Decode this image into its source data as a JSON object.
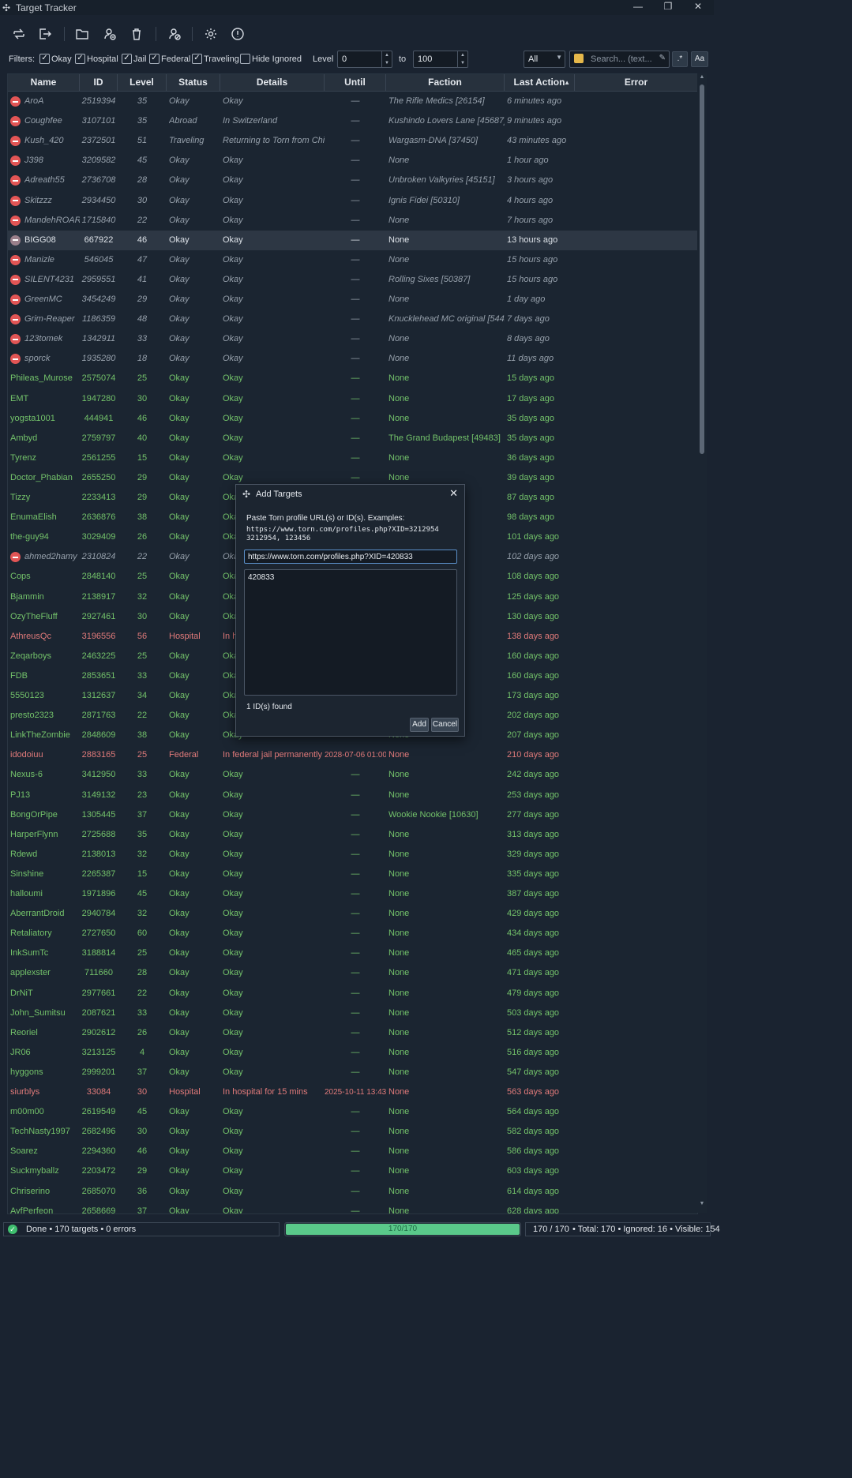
{
  "window": {
    "title": "Target Tracker"
  },
  "filters": {
    "label": "Filters:",
    "okay": "Okay",
    "hospital": "Hospital",
    "jail": "Jail",
    "federal": "Federal",
    "traveling": "Traveling",
    "hide_ignored": "Hide Ignored",
    "level_label": "Level",
    "level_min": "0",
    "to_label": "to",
    "level_max": "100",
    "scope": "All",
    "search_placeholder": "Search... (text..."
  },
  "table": {
    "columns": {
      "name": "Name",
      "id": "ID",
      "level": "Level",
      "status": "Status",
      "details": "Details",
      "until": "Until",
      "faction": "Faction",
      "last_action": "Last Action",
      "error": "Error"
    },
    "rows": [
      {
        "name": "AroA",
        "id": "2519394",
        "level": "35",
        "status": "Okay",
        "details": "Okay",
        "until": "—",
        "faction": "The Rifle Medics [26154]",
        "last": "6 minutes ago",
        "type": "ign"
      },
      {
        "name": "Coughfee",
        "id": "3107101",
        "level": "35",
        "status": "Abroad",
        "details": "In Switzerland",
        "until": "—",
        "faction": "Kushindo Lovers Lane [45687]",
        "last": "9 minutes ago",
        "type": "ign"
      },
      {
        "name": "Kush_420",
        "id": "2372501",
        "level": "51",
        "status": "Traveling",
        "details": "Returning to Torn from China",
        "until": "—",
        "faction": "Wargasm-DNA [37450]",
        "last": "43 minutes ago",
        "type": "ign"
      },
      {
        "name": "J398",
        "id": "3209582",
        "level": "45",
        "status": "Okay",
        "details": "Okay",
        "until": "—",
        "faction": "None",
        "last": "1 hour ago",
        "type": "ign"
      },
      {
        "name": "Adreath55",
        "id": "2736708",
        "level": "28",
        "status": "Okay",
        "details": "Okay",
        "until": "—",
        "faction": "Unbroken Valkyries [45151]",
        "last": "3 hours ago",
        "type": "ign"
      },
      {
        "name": "Skitzzz",
        "id": "2934450",
        "level": "30",
        "status": "Okay",
        "details": "Okay",
        "until": "—",
        "faction": "Ignis Fidei [50310]",
        "last": "4 hours ago",
        "type": "ign"
      },
      {
        "name": "MandehROAR",
        "id": "1715840",
        "level": "22",
        "status": "Okay",
        "details": "Okay",
        "until": "—",
        "faction": "None",
        "last": "7 hours ago",
        "type": "ign"
      },
      {
        "name": "BIGG08",
        "id": "667922",
        "level": "46",
        "status": "Okay",
        "details": "Okay",
        "until": "—",
        "faction": "None",
        "last": "13 hours ago",
        "type": "sel"
      },
      {
        "name": "Manizle",
        "id": "546045",
        "level": "47",
        "status": "Okay",
        "details": "Okay",
        "until": "—",
        "faction": "None",
        "last": "15 hours ago",
        "type": "ign"
      },
      {
        "name": "SILENT4231",
        "id": "2959551",
        "level": "41",
        "status": "Okay",
        "details": "Okay",
        "until": "—",
        "faction": "Rolling Sixes [50387]",
        "last": "15 hours ago",
        "type": "ign"
      },
      {
        "name": "GreenMC",
        "id": "3454249",
        "level": "29",
        "status": "Okay",
        "details": "Okay",
        "until": "—",
        "faction": "None",
        "last": "1 day ago",
        "type": "ign"
      },
      {
        "name": "Grim-Reaper",
        "id": "1186359",
        "level": "48",
        "status": "Okay",
        "details": "Okay",
        "until": "—",
        "faction": "Knucklehead MC original [54420]",
        "last": "7 days ago",
        "type": "ign"
      },
      {
        "name": "123tomek",
        "id": "1342911",
        "level": "33",
        "status": "Okay",
        "details": "Okay",
        "until": "—",
        "faction": "None",
        "last": "8 days ago",
        "type": "ign"
      },
      {
        "name": "sporck",
        "id": "1935280",
        "level": "18",
        "status": "Okay",
        "details": "Okay",
        "until": "—",
        "faction": "None",
        "last": "11 days ago",
        "type": "ign"
      },
      {
        "name": "Phileas_Murose",
        "id": "2575074",
        "level": "25",
        "status": "Okay",
        "details": "Okay",
        "until": "—",
        "faction": "None",
        "last": "15 days ago",
        "type": "ok"
      },
      {
        "name": "EMT",
        "id": "1947280",
        "level": "30",
        "status": "Okay",
        "details": "Okay",
        "until": "—",
        "faction": "None",
        "last": "17 days ago",
        "type": "ok"
      },
      {
        "name": "yogsta1001",
        "id": "444941",
        "level": "46",
        "status": "Okay",
        "details": "Okay",
        "until": "—",
        "faction": "None",
        "last": "35 days ago",
        "type": "ok"
      },
      {
        "name": "Ambyd",
        "id": "2759797",
        "level": "40",
        "status": "Okay",
        "details": "Okay",
        "until": "—",
        "faction": "The Grand Budapest [49483]",
        "last": "35 days ago",
        "type": "ok"
      },
      {
        "name": "Tyrenz",
        "id": "2561255",
        "level": "15",
        "status": "Okay",
        "details": "Okay",
        "until": "—",
        "faction": "None",
        "last": "36 days ago",
        "type": "ok"
      },
      {
        "name": "Doctor_Phabian",
        "id": "2655250",
        "level": "29",
        "status": "Okay",
        "details": "Okay",
        "until": "—",
        "faction": "None",
        "last": "39 days ago",
        "type": "ok"
      },
      {
        "name": "Tizzy",
        "id": "2233413",
        "level": "29",
        "status": "Okay",
        "details": "Okay",
        "until": "",
        "faction": "",
        "last": "87 days ago",
        "type": "ok"
      },
      {
        "name": "EnumaElish",
        "id": "2636876",
        "level": "38",
        "status": "Okay",
        "details": "Okay",
        "until": "",
        "faction": "",
        "last": "98 days ago",
        "type": "ok"
      },
      {
        "name": "the-guy94",
        "id": "3029409",
        "level": "26",
        "status": "Okay",
        "details": "Okay",
        "until": "",
        "faction": "",
        "last": "101 days ago",
        "type": "ok"
      },
      {
        "name": "ahmed2hamy",
        "id": "2310824",
        "level": "22",
        "status": "Okay",
        "details": "Okay",
        "until": "",
        "faction": "",
        "last": "102 days ago",
        "type": "ign"
      },
      {
        "name": "Cops",
        "id": "2848140",
        "level": "25",
        "status": "Okay",
        "details": "Okay",
        "until": "",
        "faction": "",
        "last": "108 days ago",
        "type": "ok"
      },
      {
        "name": "Bjammin",
        "id": "2138917",
        "level": "32",
        "status": "Okay",
        "details": "Okay",
        "until": "",
        "faction": "",
        "last": "125 days ago",
        "type": "ok"
      },
      {
        "name": "OzyTheFluff",
        "id": "2927461",
        "level": "30",
        "status": "Okay",
        "details": "Okay",
        "until": "",
        "faction": "",
        "last": "130 days ago",
        "type": "ok"
      },
      {
        "name": "AthreusQc",
        "id": "3196556",
        "level": "56",
        "status": "Hospital",
        "details": "In h",
        "until": "",
        "faction": "",
        "last": "138 days ago",
        "type": "hosp"
      },
      {
        "name": "Zeqarboys",
        "id": "2463225",
        "level": "25",
        "status": "Okay",
        "details": "Okay",
        "until": "",
        "faction": "",
        "last": "160 days ago",
        "type": "ok"
      },
      {
        "name": "FDB",
        "id": "2853651",
        "level": "33",
        "status": "Okay",
        "details": "Okay",
        "until": "",
        "faction": "",
        "last": "160 days ago",
        "type": "ok"
      },
      {
        "name": "5550123",
        "id": "1312637",
        "level": "34",
        "status": "Okay",
        "details": "Okay",
        "until": "",
        "faction": "",
        "last": "173 days ago",
        "type": "ok"
      },
      {
        "name": "presto2323",
        "id": "2871763",
        "level": "22",
        "status": "Okay",
        "details": "Okay",
        "until": "",
        "faction": "",
        "last": "202 days ago",
        "type": "ok"
      },
      {
        "name": "LinkTheZombie",
        "id": "2848609",
        "level": "38",
        "status": "Okay",
        "details": "Okay",
        "until": "",
        "faction": "None",
        "last": "207 days ago",
        "type": "ok"
      },
      {
        "name": "idodoiuu",
        "id": "2883165",
        "level": "25",
        "status": "Federal",
        "details": "In federal jail permanently",
        "until": "2028-07-06 01:00",
        "faction": "None",
        "last": "210 days ago",
        "type": "fed"
      },
      {
        "name": "Nexus-6",
        "id": "3412950",
        "level": "33",
        "status": "Okay",
        "details": "Okay",
        "until": "—",
        "faction": "None",
        "last": "242 days ago",
        "type": "ok"
      },
      {
        "name": "PJ13",
        "id": "3149132",
        "level": "23",
        "status": "Okay",
        "details": "Okay",
        "until": "—",
        "faction": "None",
        "last": "253 days ago",
        "type": "ok"
      },
      {
        "name": "BongOrPipe",
        "id": "1305445",
        "level": "37",
        "status": "Okay",
        "details": "Okay",
        "until": "—",
        "faction": "Wookie Nookie [10630]",
        "last": "277 days ago",
        "type": "ok"
      },
      {
        "name": "HarperFlynn",
        "id": "2725688",
        "level": "35",
        "status": "Okay",
        "details": "Okay",
        "until": "—",
        "faction": "None",
        "last": "313 days ago",
        "type": "ok"
      },
      {
        "name": "Rdewd",
        "id": "2138013",
        "level": "32",
        "status": "Okay",
        "details": "Okay",
        "until": "—",
        "faction": "None",
        "last": "329 days ago",
        "type": "ok"
      },
      {
        "name": "Sinshine",
        "id": "2265387",
        "level": "15",
        "status": "Okay",
        "details": "Okay",
        "until": "—",
        "faction": "None",
        "last": "335 days ago",
        "type": "ok"
      },
      {
        "name": "halloumi",
        "id": "1971896",
        "level": "45",
        "status": "Okay",
        "details": "Okay",
        "until": "—",
        "faction": "None",
        "last": "387 days ago",
        "type": "ok"
      },
      {
        "name": "AberrantDroid",
        "id": "2940784",
        "level": "32",
        "status": "Okay",
        "details": "Okay",
        "until": "—",
        "faction": "None",
        "last": "429 days ago",
        "type": "ok"
      },
      {
        "name": "Retaliatory",
        "id": "2727650",
        "level": "60",
        "status": "Okay",
        "details": "Okay",
        "until": "—",
        "faction": "None",
        "last": "434 days ago",
        "type": "ok"
      },
      {
        "name": "InkSumTc",
        "id": "3188814",
        "level": "25",
        "status": "Okay",
        "details": "Okay",
        "until": "—",
        "faction": "None",
        "last": "465 days ago",
        "type": "ok"
      },
      {
        "name": "applexster",
        "id": "711660",
        "level": "28",
        "status": "Okay",
        "details": "Okay",
        "until": "—",
        "faction": "None",
        "last": "471 days ago",
        "type": "ok"
      },
      {
        "name": "DrNiT",
        "id": "2977661",
        "level": "22",
        "status": "Okay",
        "details": "Okay",
        "until": "—",
        "faction": "None",
        "last": "479 days ago",
        "type": "ok"
      },
      {
        "name": "John_Sumitsu",
        "id": "2087621",
        "level": "33",
        "status": "Okay",
        "details": "Okay",
        "until": "—",
        "faction": "None",
        "last": "503 days ago",
        "type": "ok"
      },
      {
        "name": "Reoriel",
        "id": "2902612",
        "level": "26",
        "status": "Okay",
        "details": "Okay",
        "until": "—",
        "faction": "None",
        "last": "512 days ago",
        "type": "ok"
      },
      {
        "name": "JR06",
        "id": "3213125",
        "level": "4",
        "status": "Okay",
        "details": "Okay",
        "until": "—",
        "faction": "None",
        "last": "516 days ago",
        "type": "ok"
      },
      {
        "name": "hyggons",
        "id": "2999201",
        "level": "37",
        "status": "Okay",
        "details": "Okay",
        "until": "—",
        "faction": "None",
        "last": "547 days ago",
        "type": "ok"
      },
      {
        "name": "siurblys",
        "id": "33084",
        "level": "30",
        "status": "Hospital",
        "details": "In hospital for 15 mins",
        "until": "2025-10-11 13:43",
        "faction": "None",
        "last": "563 days ago",
        "type": "hosp"
      },
      {
        "name": "m00m00",
        "id": "2619549",
        "level": "45",
        "status": "Okay",
        "details": "Okay",
        "until": "—",
        "faction": "None",
        "last": "564 days ago",
        "type": "ok"
      },
      {
        "name": "TechNasty1997",
        "id": "2682496",
        "level": "30",
        "status": "Okay",
        "details": "Okay",
        "until": "—",
        "faction": "None",
        "last": "582 days ago",
        "type": "ok"
      },
      {
        "name": "Soarez",
        "id": "2294360",
        "level": "46",
        "status": "Okay",
        "details": "Okay",
        "until": "—",
        "faction": "None",
        "last": "586 days ago",
        "type": "ok"
      },
      {
        "name": "Suckmyballz",
        "id": "2203472",
        "level": "29",
        "status": "Okay",
        "details": "Okay",
        "until": "—",
        "faction": "None",
        "last": "603 days ago",
        "type": "ok"
      },
      {
        "name": "Chriserino",
        "id": "2685070",
        "level": "36",
        "status": "Okay",
        "details": "Okay",
        "until": "—",
        "faction": "None",
        "last": "614 days ago",
        "type": "ok"
      },
      {
        "name": "AvfPerfeon",
        "id": "2658669",
        "level": "37",
        "status": "Okay",
        "details": "Okay",
        "until": "—",
        "faction": "None",
        "last": "628 days ago",
        "type": "ok"
      }
    ]
  },
  "dialog": {
    "title": "Add Targets",
    "instructions": "Paste Torn profile URL(s) or ID(s). Examples:",
    "example1": "https://www.torn.com/profiles.php?XID=3212954",
    "example2": "3212954, 123456",
    "input_value": "https://www.torn.com/profiles.php?XID=420833",
    "parsed_ids": "420833",
    "found_text": "1 ID(s) found",
    "add_label": "Add",
    "cancel_label": "Cancel"
  },
  "status": {
    "message": "Done • 170 targets • 0 errors",
    "progress_text": "170/170",
    "progress_fraction": 1.0,
    "count": "170 / 170",
    "summary": "• Total: 170 • Ignored: 16 • Visible: 154"
  },
  "colors": {
    "okay": "#73c26a",
    "hospital": "#e07a7a",
    "ignored": "#96a0ab",
    "progress": "#5ac98a",
    "background": "#1a2330"
  }
}
